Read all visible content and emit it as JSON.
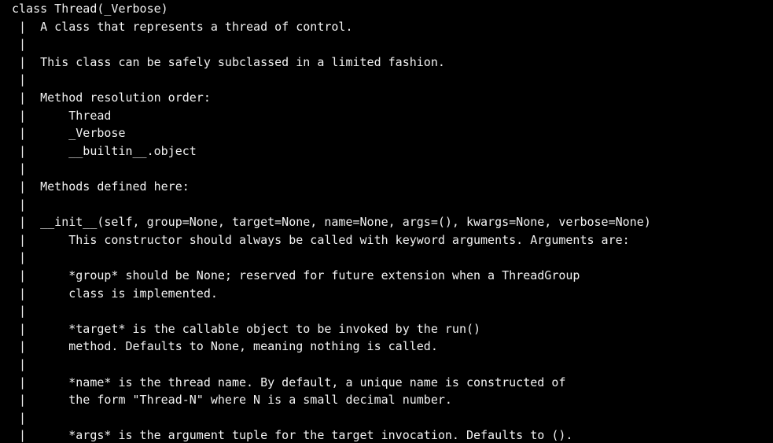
{
  "lines": [
    "class Thread(_Verbose)",
    " |  A class that represents a thread of control.",
    " |",
    " |  This class can be safely subclassed in a limited fashion.",
    " |",
    " |  Method resolution order:",
    " |      Thread",
    " |      _Verbose",
    " |      __builtin__.object",
    " |",
    " |  Methods defined here:",
    " |",
    " |  __init__(self, group=None, target=None, name=None, args=(), kwargs=None, verbose=None)",
    " |      This constructor should always be called with keyword arguments. Arguments are:",
    " |",
    " |      *group* should be None; reserved for future extension when a ThreadGroup",
    " |      class is implemented.",
    " |",
    " |      *target* is the callable object to be invoked by the run()",
    " |      method. Defaults to None, meaning nothing is called.",
    " |",
    " |      *name* is the thread name. By default, a unique name is constructed of",
    " |      the form \"Thread-N\" where N is a small decimal number.",
    " |",
    " |      *args* is the argument tuple for the target invocation. Defaults to ()."
  ]
}
